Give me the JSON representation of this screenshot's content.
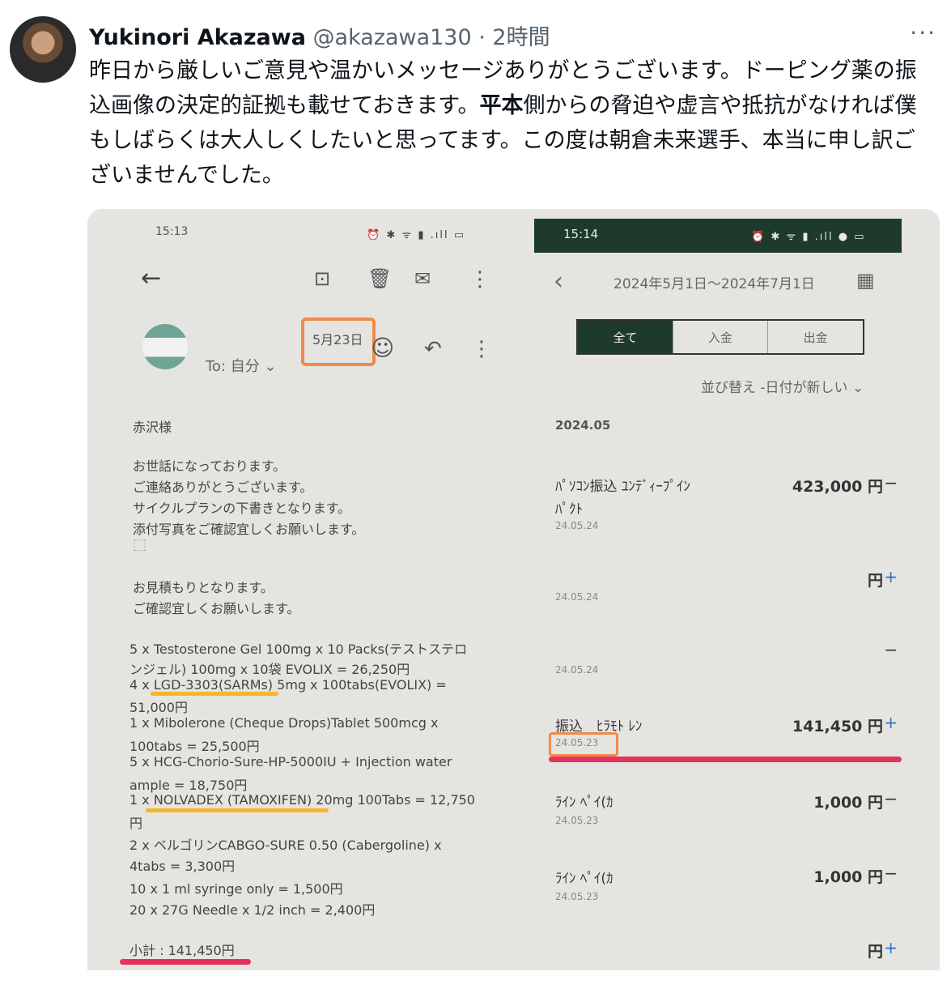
{
  "tweet": {
    "name": "Yukinori Akazawa",
    "handle": "@akazawa130",
    "time": "· 2時間",
    "more": "···",
    "text_1": "昨日から厳しいご意見や温かいメッセージありがとうございます。ドーピング薬の振込画像の決定的証拠も載せておきます。",
    "text_bold": "平本",
    "text_2": "側からの脅迫や虚言や抵抗がなければ僕もしばらくは大人しくしたいと思ってます。この度は朝倉未来選手、本当に申し訳ございませんでした。"
  },
  "email": {
    "status_time": "15:13",
    "status_icons": "⏰ ✱ ᯤ ▮ .ıll ▭",
    "to": "To: 自分 ⌄",
    "date": "5月23日",
    "greeting": "赤沢様",
    "body": [
      "お世話になっております。",
      "ご連絡ありがとうございます。",
      "サイクルプランの下書きとなります。",
      "添付写真をご確認宜しくお願いします。"
    ],
    "body2": [
      "お見積もりとなります。",
      "ご確認宜しくお願いします。"
    ],
    "items": [
      "5 x Testosterone Gel 100mg x 10 Packs(テストステロ",
      "ンジェル) 100mg x 10袋 EVOLIX = 26,250円",
      "4 x LGD-3303(SARMs) 5mg x 100tabs(EVOLIX) =",
      "51,000円",
      "1 x Mibolerone (Cheque Drops)Tablet 500mcg x",
      "100tabs = 25,500円",
      "5 x HCG-Chorio-Sure-HP-5000IU + Injection water",
      "ample = 18,750円",
      "1 x NOLVADEX (TAMOXIFEN) 20mg 100Tabs = 12,750",
      "円",
      "2 x ベルゴリンCABGO-SURE 0.50 (Cabergoline) x",
      "4tabs = 3,300円",
      "10 x 1 ml syringe only = 1,500円",
      "20 x 27G Needle x 1/2 inch = 2,400円"
    ],
    "subtotal": "小計 : 141,450円"
  },
  "bank": {
    "status_time": "15:14",
    "status_icons": "⏰ ✱ ᯤ ▮ .ıll ● ▭",
    "range": "2024年5月1日〜2024年7月1日",
    "tabs": [
      "全て",
      "入金",
      "出金"
    ],
    "sort": "並び替え  -日付が新しい  ⌄",
    "month": "2024.05",
    "transactions": [
      {
        "name": "ﾊﾟｿｺﾝ振込 ﾕﾝﾃﾞｨｰﾌﾟｲﾝ",
        "sub": "ﾊﾟｸﾄ",
        "date": "24.05.24",
        "amount": "423,000 円",
        "sign": "−"
      },
      {
        "name": "",
        "sub": "",
        "date": "24.05.24",
        "amount": "円",
        "sign": "+"
      },
      {
        "name": "",
        "sub": "",
        "date": "24.05.24",
        "amount": "",
        "sign": "−"
      },
      {
        "name": "振込　ﾋﾗﾓﾄ ﾚﾝ",
        "sub": "",
        "date": "24.05.23",
        "amount": "141,450 円",
        "sign": "+"
      },
      {
        "name": "ﾗｲﾝ ﾍﾟｲ(ｶ",
        "sub": "",
        "date": "24.05.23",
        "amount": "1,000 円",
        "sign": "−"
      },
      {
        "name": "ﾗｲﾝ ﾍﾟｲ(ｶ",
        "sub": "",
        "date": "24.05.23",
        "amount": "1,000 円",
        "sign": "−"
      },
      {
        "name": "",
        "sub": "",
        "date": "",
        "amount": "円",
        "sign": "+"
      }
    ]
  },
  "colors": {
    "accent_orange": "#f08a4b",
    "underline_yellow": "#f5b72a",
    "underline_red": "#e5325b",
    "bank_dark": "#1d3a2a"
  }
}
